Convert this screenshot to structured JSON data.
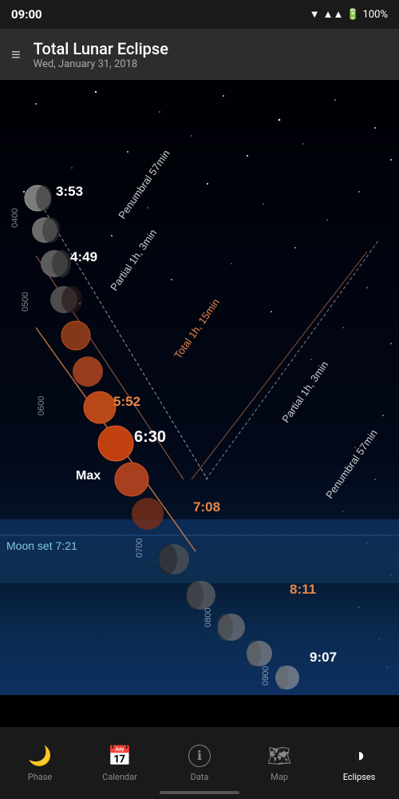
{
  "status": {
    "time": "09:00",
    "battery": "100%",
    "wifi": true,
    "signal": true
  },
  "header": {
    "title": "Total Lunar Eclipse",
    "subtitle": "Wed, January 31, 2018",
    "menu_label": "≡"
  },
  "eclipse": {
    "times": {
      "t1": "3:53",
      "t2": "4:49",
      "t3": "5:52",
      "t4": "6:30",
      "t5": "7:08",
      "t6": "8:11",
      "t7": "9:07"
    },
    "durations": {
      "penumbral1": "Penumbral 57min",
      "partial1": "Partial 1h, 3min",
      "total": "Total  1h, 15min",
      "partial2": "Partial 1h, 3min",
      "penumbral2": "Penumbral 57min"
    },
    "max_label": "Max",
    "moon_set": "Moon set 7:21",
    "hour_markers": [
      "0400",
      "0500",
      "0600",
      "0700",
      "0800",
      "0900"
    ]
  },
  "nav": {
    "items": [
      {
        "id": "phase",
        "label": "Phase",
        "icon": "🌙",
        "active": false
      },
      {
        "id": "calendar",
        "label": "Calendar",
        "icon": "📅",
        "active": false
      },
      {
        "id": "data",
        "label": "Data",
        "icon": "ℹ",
        "active": false
      },
      {
        "id": "map",
        "label": "Map",
        "icon": "🗺",
        "active": false
      },
      {
        "id": "eclipses",
        "label": "Eclipses",
        "icon": "◑",
        "active": true
      }
    ]
  }
}
